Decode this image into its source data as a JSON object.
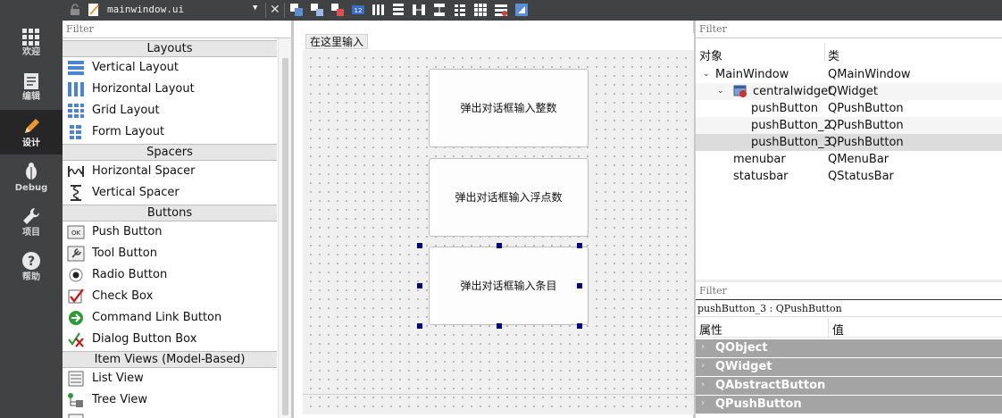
{
  "modes": [
    {
      "label": "欢迎",
      "icon": "grid-icon"
    },
    {
      "label": "编辑",
      "icon": "document-icon"
    },
    {
      "label": "设计",
      "icon": "pencil-icon"
    },
    {
      "label": "Debug",
      "icon": "bug-icon"
    },
    {
      "label": "项目",
      "icon": "wrench-icon"
    },
    {
      "label": "帮助",
      "icon": "help-icon"
    }
  ],
  "toolbar": {
    "filename": "mainwindow.ui",
    "close": "✕"
  },
  "widgetbox": {
    "filter": "Filter",
    "categories": {
      "layouts": "Layouts",
      "spacers": "Spacers",
      "buttons": "Buttons",
      "itemviews": "Item Views (Model-Based)"
    },
    "items": {
      "vertical_layout": "Vertical Layout",
      "horizontal_layout": "Horizontal Layout",
      "grid_layout": "Grid Layout",
      "form_layout": "Form Layout",
      "horizontal_spacer": "Horizontal Spacer",
      "vertical_spacer": "Vertical Spacer",
      "push_button": "Push Button",
      "tool_button": "Tool Button",
      "radio_button": "Radio Button",
      "check_box": "Check Box",
      "command_link_button": "Command Link Button",
      "dialog_button_box": "Dialog Button Box",
      "list_view": "List View",
      "tree_view": "Tree View"
    }
  },
  "form": {
    "menu_placeholder": "在这里输入",
    "buttons": [
      "弹出对话框输入整数",
      "弹出对话框输入浮点数",
      "弹出对话框输入条目"
    ]
  },
  "object_inspector": {
    "filter": "Filter",
    "col_object": "对象",
    "col_class": "类",
    "rows": [
      {
        "name": "MainWindow",
        "cls": "QMainWindow"
      },
      {
        "name": "centralwidget",
        "cls": "QWidget"
      },
      {
        "name": "pushButton",
        "cls": "QPushButton"
      },
      {
        "name": "pushButton_2",
        "cls": "QPushButton"
      },
      {
        "name": "pushButton_3",
        "cls": "QPushButton"
      },
      {
        "name": "menubar",
        "cls": "QMenuBar"
      },
      {
        "name": "statusbar",
        "cls": "QStatusBar"
      }
    ]
  },
  "property_editor": {
    "filter": "Filter",
    "selected": "pushButton_3 : QPushButton",
    "col_property": "属性",
    "col_value": "值",
    "groups": [
      "QObject",
      "QWidget",
      "QAbstractButton",
      "QPushButton"
    ]
  }
}
